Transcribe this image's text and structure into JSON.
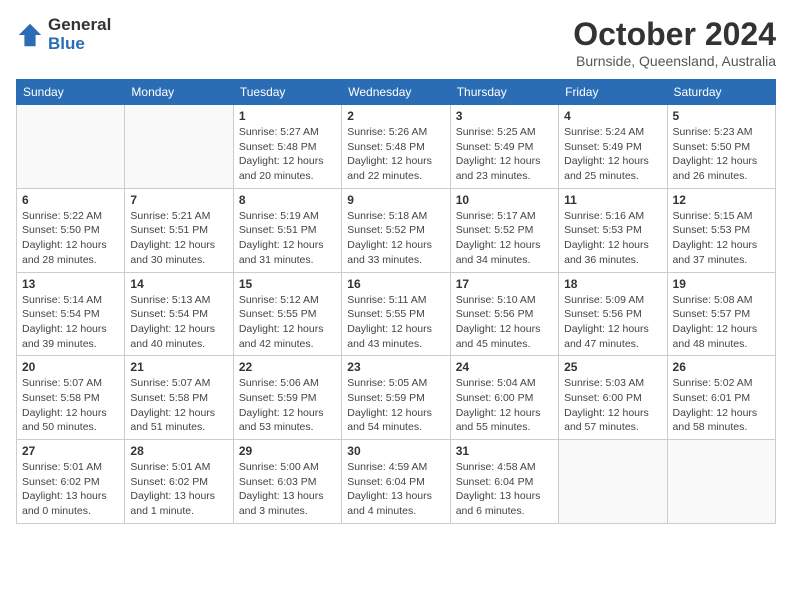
{
  "logo": {
    "general": "General",
    "blue": "Blue"
  },
  "title": "October 2024",
  "location": "Burnside, Queensland, Australia",
  "days_header": [
    "Sunday",
    "Monday",
    "Tuesday",
    "Wednesday",
    "Thursday",
    "Friday",
    "Saturday"
  ],
  "weeks": [
    [
      {
        "num": "",
        "info": ""
      },
      {
        "num": "",
        "info": ""
      },
      {
        "num": "1",
        "info": "Sunrise: 5:27 AM\nSunset: 5:48 PM\nDaylight: 12 hours and 20 minutes."
      },
      {
        "num": "2",
        "info": "Sunrise: 5:26 AM\nSunset: 5:48 PM\nDaylight: 12 hours and 22 minutes."
      },
      {
        "num": "3",
        "info": "Sunrise: 5:25 AM\nSunset: 5:49 PM\nDaylight: 12 hours and 23 minutes."
      },
      {
        "num": "4",
        "info": "Sunrise: 5:24 AM\nSunset: 5:49 PM\nDaylight: 12 hours and 25 minutes."
      },
      {
        "num": "5",
        "info": "Sunrise: 5:23 AM\nSunset: 5:50 PM\nDaylight: 12 hours and 26 minutes."
      }
    ],
    [
      {
        "num": "6",
        "info": "Sunrise: 5:22 AM\nSunset: 5:50 PM\nDaylight: 12 hours and 28 minutes."
      },
      {
        "num": "7",
        "info": "Sunrise: 5:21 AM\nSunset: 5:51 PM\nDaylight: 12 hours and 30 minutes."
      },
      {
        "num": "8",
        "info": "Sunrise: 5:19 AM\nSunset: 5:51 PM\nDaylight: 12 hours and 31 minutes."
      },
      {
        "num": "9",
        "info": "Sunrise: 5:18 AM\nSunset: 5:52 PM\nDaylight: 12 hours and 33 minutes."
      },
      {
        "num": "10",
        "info": "Sunrise: 5:17 AM\nSunset: 5:52 PM\nDaylight: 12 hours and 34 minutes."
      },
      {
        "num": "11",
        "info": "Sunrise: 5:16 AM\nSunset: 5:53 PM\nDaylight: 12 hours and 36 minutes."
      },
      {
        "num": "12",
        "info": "Sunrise: 5:15 AM\nSunset: 5:53 PM\nDaylight: 12 hours and 37 minutes."
      }
    ],
    [
      {
        "num": "13",
        "info": "Sunrise: 5:14 AM\nSunset: 5:54 PM\nDaylight: 12 hours and 39 minutes."
      },
      {
        "num": "14",
        "info": "Sunrise: 5:13 AM\nSunset: 5:54 PM\nDaylight: 12 hours and 40 minutes."
      },
      {
        "num": "15",
        "info": "Sunrise: 5:12 AM\nSunset: 5:55 PM\nDaylight: 12 hours and 42 minutes."
      },
      {
        "num": "16",
        "info": "Sunrise: 5:11 AM\nSunset: 5:55 PM\nDaylight: 12 hours and 43 minutes."
      },
      {
        "num": "17",
        "info": "Sunrise: 5:10 AM\nSunset: 5:56 PM\nDaylight: 12 hours and 45 minutes."
      },
      {
        "num": "18",
        "info": "Sunrise: 5:09 AM\nSunset: 5:56 PM\nDaylight: 12 hours and 47 minutes."
      },
      {
        "num": "19",
        "info": "Sunrise: 5:08 AM\nSunset: 5:57 PM\nDaylight: 12 hours and 48 minutes."
      }
    ],
    [
      {
        "num": "20",
        "info": "Sunrise: 5:07 AM\nSunset: 5:58 PM\nDaylight: 12 hours and 50 minutes."
      },
      {
        "num": "21",
        "info": "Sunrise: 5:07 AM\nSunset: 5:58 PM\nDaylight: 12 hours and 51 minutes."
      },
      {
        "num": "22",
        "info": "Sunrise: 5:06 AM\nSunset: 5:59 PM\nDaylight: 12 hours and 53 minutes."
      },
      {
        "num": "23",
        "info": "Sunrise: 5:05 AM\nSunset: 5:59 PM\nDaylight: 12 hours and 54 minutes."
      },
      {
        "num": "24",
        "info": "Sunrise: 5:04 AM\nSunset: 6:00 PM\nDaylight: 12 hours and 55 minutes."
      },
      {
        "num": "25",
        "info": "Sunrise: 5:03 AM\nSunset: 6:00 PM\nDaylight: 12 hours and 57 minutes."
      },
      {
        "num": "26",
        "info": "Sunrise: 5:02 AM\nSunset: 6:01 PM\nDaylight: 12 hours and 58 minutes."
      }
    ],
    [
      {
        "num": "27",
        "info": "Sunrise: 5:01 AM\nSunset: 6:02 PM\nDaylight: 13 hours and 0 minutes."
      },
      {
        "num": "28",
        "info": "Sunrise: 5:01 AM\nSunset: 6:02 PM\nDaylight: 13 hours and 1 minute."
      },
      {
        "num": "29",
        "info": "Sunrise: 5:00 AM\nSunset: 6:03 PM\nDaylight: 13 hours and 3 minutes."
      },
      {
        "num": "30",
        "info": "Sunrise: 4:59 AM\nSunset: 6:04 PM\nDaylight: 13 hours and 4 minutes."
      },
      {
        "num": "31",
        "info": "Sunrise: 4:58 AM\nSunset: 6:04 PM\nDaylight: 13 hours and 6 minutes."
      },
      {
        "num": "",
        "info": ""
      },
      {
        "num": "",
        "info": ""
      }
    ]
  ]
}
